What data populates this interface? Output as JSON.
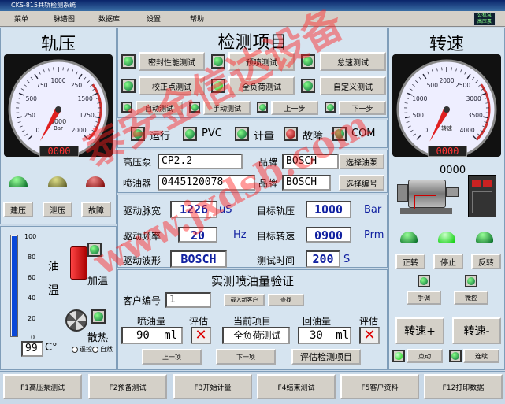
{
  "window": {
    "title": "CKS-815共轨检测系统"
  },
  "menu": [
    "菜单",
    "脉谱图",
    "数据库",
    "设置",
    "帮助"
  ],
  "corner_badge": "公机泵\n高压泵",
  "rail_pressure": {
    "title": "轨压",
    "gauge_ticks": [
      "0",
      "250",
      "500",
      "750",
      "1000",
      "1250",
      "1500",
      "1750",
      "2000"
    ],
    "gauge_unit": "Bar",
    "gauge_value_label": "0000",
    "readout": "0000",
    "buttons": [
      "建压",
      "泄压",
      "故障"
    ]
  },
  "oil_temp": {
    "label_oil": "油",
    "label_temp": "温",
    "scale": [
      "100",
      "80",
      "60",
      "40",
      "20",
      "0"
    ],
    "value": "99",
    "unit": "C°",
    "heat_label": "加温",
    "cool_label": "散热",
    "mode_auto_label": "遥控",
    "mode_manual_label": "自然"
  },
  "test_items": {
    "title": "检测项目",
    "buttons": [
      "密封性能测试",
      "预喷测试",
      "怠速测试",
      "校正点测试",
      "全负荷测试",
      "自定义测试"
    ],
    "controls": [
      "自动测试",
      "手动测试",
      "上一步",
      "下一步"
    ]
  },
  "status": {
    "items": [
      "运行",
      "PVC",
      "计量",
      "故障",
      "COM"
    ]
  },
  "pump_info": {
    "pump_label": "高压泵",
    "pump_value": "CP2.2",
    "brand_label": "品牌",
    "brand_value": "BOSCH",
    "select_pump": "选择油泵",
    "injector_label": "喷油器",
    "injector_value": "0445120078",
    "injector_brand_label": "品牌",
    "injector_brand_value": "BOSCH",
    "select_code": "选择编号"
  },
  "drive": {
    "pulse_width_label": "驱动脉宽",
    "pulse_width_value": "1226",
    "pulse_width_unit": "uS",
    "target_rail_label": "目标轨压",
    "target_rail_value": "1000",
    "target_rail_unit": "Bar",
    "freq_label": "驱动频率",
    "freq_value": "20",
    "freq_unit": "Hz",
    "target_speed_label": "目标转速",
    "target_speed_value": "0900",
    "target_speed_unit": "Prm",
    "waveform_label": "驱动波形",
    "waveform_value": "BOSCH",
    "test_time_label": "测试时间",
    "test_time_value": "200",
    "test_time_unit": "S"
  },
  "verify": {
    "title": "实测喷油量验证",
    "customer_label": "客户编号",
    "customer_value": "1",
    "import_btn": "载入新客户",
    "find_btn": "查找",
    "inj_qty_label": "喷油量",
    "inj_qty_value": "90",
    "inj_qty_unit": "ml",
    "eval_label_1": "评估",
    "current_item_label": "当前项目",
    "current_item_value": "全负荷测试",
    "return_qty_label": "回油量",
    "return_qty_value": "30",
    "return_qty_unit": "ml",
    "eval_label_2": "评估",
    "prev_btn": "上一项",
    "next_btn": "下一项",
    "eval_btn": "评估检测项目"
  },
  "speed": {
    "title": "转速",
    "gauge_ticks": [
      "0",
      "500",
      "1000",
      "1500",
      "2000",
      "2500",
      "3000",
      "3500",
      "4000"
    ],
    "gauge_unit": "转速",
    "readout": "0000",
    "motor_readout": "0000",
    "dir_buttons": [
      "正转",
      "停止",
      "反转"
    ],
    "mode_labels": [
      "手调",
      "微控"
    ],
    "speed_up": "转速+",
    "speed_down": "转速-",
    "jog_label": "点动",
    "link_label": "连续"
  },
  "fkeys": [
    "F1高压泵测试",
    "F2预备测试",
    "F3开始计量",
    "F4结束测试",
    "F5客户资料",
    "F12打印数据"
  ],
  "watermark": {
    "line1": "泰安金信达设备",
    "line2": "www.jxdsb.com"
  },
  "colors": {
    "panel": "#d6e4f0",
    "lcd_text": "#1020a0",
    "needle": "#e02020",
    "watermark": "#ff1e1e"
  }
}
